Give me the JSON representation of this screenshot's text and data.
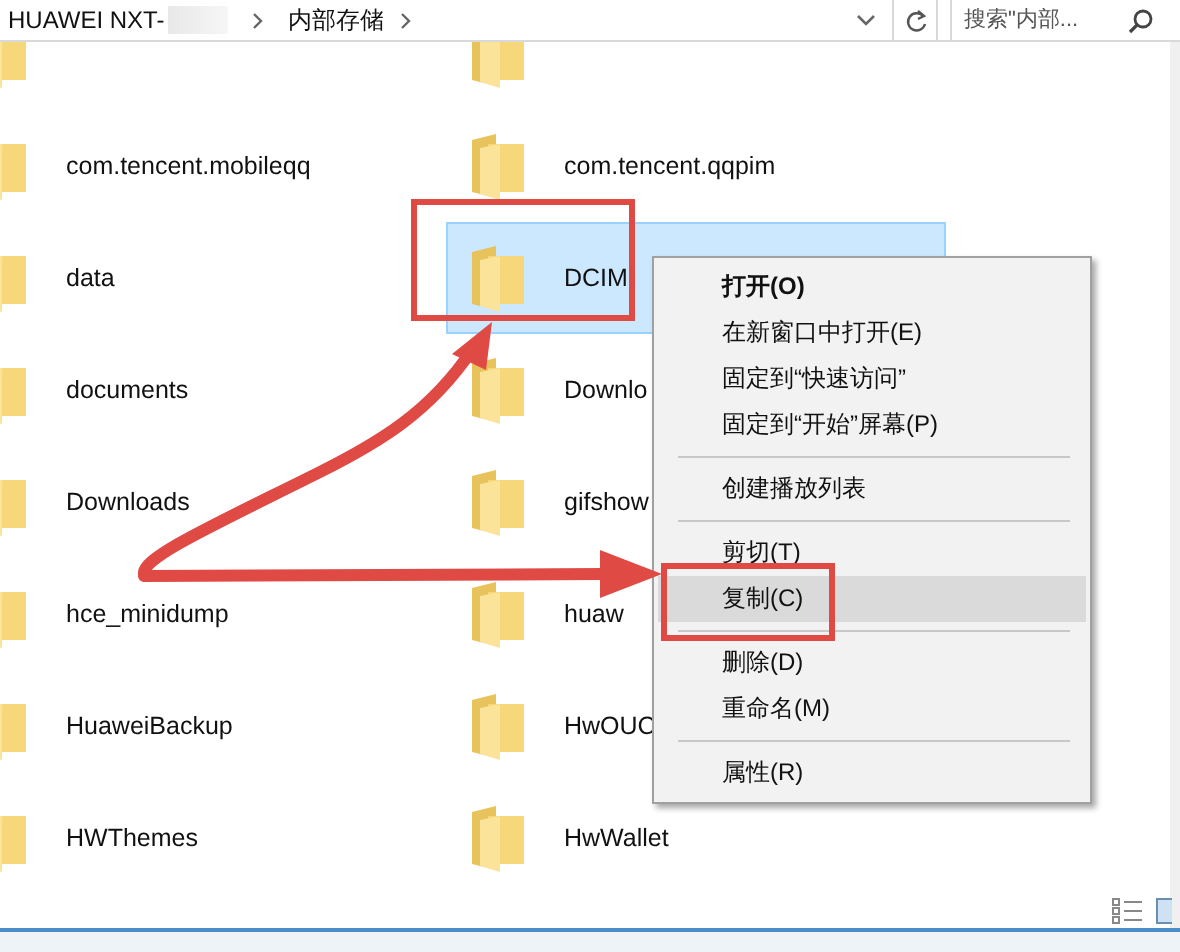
{
  "address_bar": {
    "segments": [
      {
        "label": "HUAWEI NXT-",
        "redacted": true
      },
      {
        "label": "内部存储",
        "redacted": false
      }
    ],
    "search": {
      "placeholder": "搜索\"内部..."
    }
  },
  "folders": [
    {
      "selected": false
    },
    {
      "selected": false
    },
    {
      "name": "com.tencent.mobileqq",
      "selected": false
    },
    {
      "name": "com.tencent.qqpim",
      "selected": false
    },
    {
      "name": "data",
      "selected": false
    },
    {
      "name": "DCIM",
      "selected": true
    },
    {
      "name": "documents",
      "selected": false
    },
    {
      "name": "Downlo",
      "selected": false
    },
    {
      "name": "Downloads",
      "selected": false
    },
    {
      "name": "gifshow",
      "selected": false
    },
    {
      "name": "hce_minidump",
      "selected": false
    },
    {
      "name": "huaw",
      "selected": false
    },
    {
      "name": "HuaweiBackup",
      "selected": false
    },
    {
      "name": "HwOUC",
      "selected": false
    },
    {
      "name": "HWThemes",
      "selected": false
    },
    {
      "name": "HwWallet",
      "selected": false
    }
  ],
  "context_menu": {
    "items": [
      {
        "kind": "item",
        "label": "打开(O)",
        "bold": true,
        "selected": false
      },
      {
        "kind": "item",
        "label": "在新窗口中打开(E)",
        "bold": false,
        "selected": false
      },
      {
        "kind": "item",
        "label": "固定到“快速访问”",
        "bold": false,
        "selected": false
      },
      {
        "kind": "item",
        "label": "固定到“开始”屏幕(P)",
        "bold": false,
        "selected": false
      },
      {
        "kind": "separator"
      },
      {
        "kind": "item",
        "label": "创建播放列表",
        "bold": false,
        "selected": false
      },
      {
        "kind": "separator"
      },
      {
        "kind": "item",
        "label": "剪切(T)",
        "bold": false,
        "selected": false
      },
      {
        "kind": "item",
        "label": "复制(C)",
        "bold": false,
        "selected": true
      },
      {
        "kind": "separator"
      },
      {
        "kind": "item",
        "label": "删除(D)",
        "bold": false,
        "selected": false
      },
      {
        "kind": "item",
        "label": "重命名(M)",
        "bold": false,
        "selected": false
      },
      {
        "kind": "separator"
      },
      {
        "kind": "item",
        "label": "属性(R)",
        "bold": false,
        "selected": false
      }
    ]
  }
}
